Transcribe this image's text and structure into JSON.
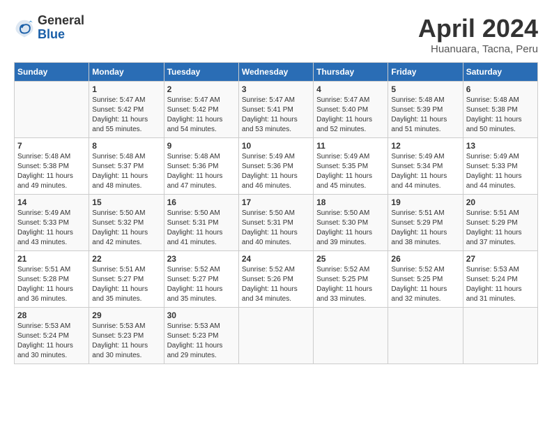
{
  "header": {
    "logo": {
      "general": "General",
      "blue": "Blue"
    },
    "title": "April 2024",
    "location": "Huanuara, Tacna, Peru"
  },
  "weekdays": [
    "Sunday",
    "Monday",
    "Tuesday",
    "Wednesday",
    "Thursday",
    "Friday",
    "Saturday"
  ],
  "weeks": [
    [
      {
        "day": "",
        "empty": true
      },
      {
        "day": "1",
        "sunrise": "Sunrise: 5:47 AM",
        "sunset": "Sunset: 5:42 PM",
        "daylight": "Daylight: 11 hours and 55 minutes."
      },
      {
        "day": "2",
        "sunrise": "Sunrise: 5:47 AM",
        "sunset": "Sunset: 5:42 PM",
        "daylight": "Daylight: 11 hours and 54 minutes."
      },
      {
        "day": "3",
        "sunrise": "Sunrise: 5:47 AM",
        "sunset": "Sunset: 5:41 PM",
        "daylight": "Daylight: 11 hours and 53 minutes."
      },
      {
        "day": "4",
        "sunrise": "Sunrise: 5:47 AM",
        "sunset": "Sunset: 5:40 PM",
        "daylight": "Daylight: 11 hours and 52 minutes."
      },
      {
        "day": "5",
        "sunrise": "Sunrise: 5:48 AM",
        "sunset": "Sunset: 5:39 PM",
        "daylight": "Daylight: 11 hours and 51 minutes."
      },
      {
        "day": "6",
        "sunrise": "Sunrise: 5:48 AM",
        "sunset": "Sunset: 5:38 PM",
        "daylight": "Daylight: 11 hours and 50 minutes."
      }
    ],
    [
      {
        "day": "7",
        "sunrise": "Sunrise: 5:48 AM",
        "sunset": "Sunset: 5:38 PM",
        "daylight": "Daylight: 11 hours and 49 minutes."
      },
      {
        "day": "8",
        "sunrise": "Sunrise: 5:48 AM",
        "sunset": "Sunset: 5:37 PM",
        "daylight": "Daylight: 11 hours and 48 minutes."
      },
      {
        "day": "9",
        "sunrise": "Sunrise: 5:48 AM",
        "sunset": "Sunset: 5:36 PM",
        "daylight": "Daylight: 11 hours and 47 minutes."
      },
      {
        "day": "10",
        "sunrise": "Sunrise: 5:49 AM",
        "sunset": "Sunset: 5:36 PM",
        "daylight": "Daylight: 11 hours and 46 minutes."
      },
      {
        "day": "11",
        "sunrise": "Sunrise: 5:49 AM",
        "sunset": "Sunset: 5:35 PM",
        "daylight": "Daylight: 11 hours and 45 minutes."
      },
      {
        "day": "12",
        "sunrise": "Sunrise: 5:49 AM",
        "sunset": "Sunset: 5:34 PM",
        "daylight": "Daylight: 11 hours and 44 minutes."
      },
      {
        "day": "13",
        "sunrise": "Sunrise: 5:49 AM",
        "sunset": "Sunset: 5:33 PM",
        "daylight": "Daylight: 11 hours and 44 minutes."
      }
    ],
    [
      {
        "day": "14",
        "sunrise": "Sunrise: 5:49 AM",
        "sunset": "Sunset: 5:33 PM",
        "daylight": "Daylight: 11 hours and 43 minutes."
      },
      {
        "day": "15",
        "sunrise": "Sunrise: 5:50 AM",
        "sunset": "Sunset: 5:32 PM",
        "daylight": "Daylight: 11 hours and 42 minutes."
      },
      {
        "day": "16",
        "sunrise": "Sunrise: 5:50 AM",
        "sunset": "Sunset: 5:31 PM",
        "daylight": "Daylight: 11 hours and 41 minutes."
      },
      {
        "day": "17",
        "sunrise": "Sunrise: 5:50 AM",
        "sunset": "Sunset: 5:31 PM",
        "daylight": "Daylight: 11 hours and 40 minutes."
      },
      {
        "day": "18",
        "sunrise": "Sunrise: 5:50 AM",
        "sunset": "Sunset: 5:30 PM",
        "daylight": "Daylight: 11 hours and 39 minutes."
      },
      {
        "day": "19",
        "sunrise": "Sunrise: 5:51 AM",
        "sunset": "Sunset: 5:29 PM",
        "daylight": "Daylight: 11 hours and 38 minutes."
      },
      {
        "day": "20",
        "sunrise": "Sunrise: 5:51 AM",
        "sunset": "Sunset: 5:29 PM",
        "daylight": "Daylight: 11 hours and 37 minutes."
      }
    ],
    [
      {
        "day": "21",
        "sunrise": "Sunrise: 5:51 AM",
        "sunset": "Sunset: 5:28 PM",
        "daylight": "Daylight: 11 hours and 36 minutes."
      },
      {
        "day": "22",
        "sunrise": "Sunrise: 5:51 AM",
        "sunset": "Sunset: 5:27 PM",
        "daylight": "Daylight: 11 hours and 35 minutes."
      },
      {
        "day": "23",
        "sunrise": "Sunrise: 5:52 AM",
        "sunset": "Sunset: 5:27 PM",
        "daylight": "Daylight: 11 hours and 35 minutes."
      },
      {
        "day": "24",
        "sunrise": "Sunrise: 5:52 AM",
        "sunset": "Sunset: 5:26 PM",
        "daylight": "Daylight: 11 hours and 34 minutes."
      },
      {
        "day": "25",
        "sunrise": "Sunrise: 5:52 AM",
        "sunset": "Sunset: 5:25 PM",
        "daylight": "Daylight: 11 hours and 33 minutes."
      },
      {
        "day": "26",
        "sunrise": "Sunrise: 5:52 AM",
        "sunset": "Sunset: 5:25 PM",
        "daylight": "Daylight: 11 hours and 32 minutes."
      },
      {
        "day": "27",
        "sunrise": "Sunrise: 5:53 AM",
        "sunset": "Sunset: 5:24 PM",
        "daylight": "Daylight: 11 hours and 31 minutes."
      }
    ],
    [
      {
        "day": "28",
        "sunrise": "Sunrise: 5:53 AM",
        "sunset": "Sunset: 5:24 PM",
        "daylight": "Daylight: 11 hours and 30 minutes."
      },
      {
        "day": "29",
        "sunrise": "Sunrise: 5:53 AM",
        "sunset": "Sunset: 5:23 PM",
        "daylight": "Daylight: 11 hours and 30 minutes."
      },
      {
        "day": "30",
        "sunrise": "Sunrise: 5:53 AM",
        "sunset": "Sunset: 5:23 PM",
        "daylight": "Daylight: 11 hours and 29 minutes."
      },
      {
        "day": "",
        "empty": true
      },
      {
        "day": "",
        "empty": true
      },
      {
        "day": "",
        "empty": true
      },
      {
        "day": "",
        "empty": true
      }
    ]
  ]
}
